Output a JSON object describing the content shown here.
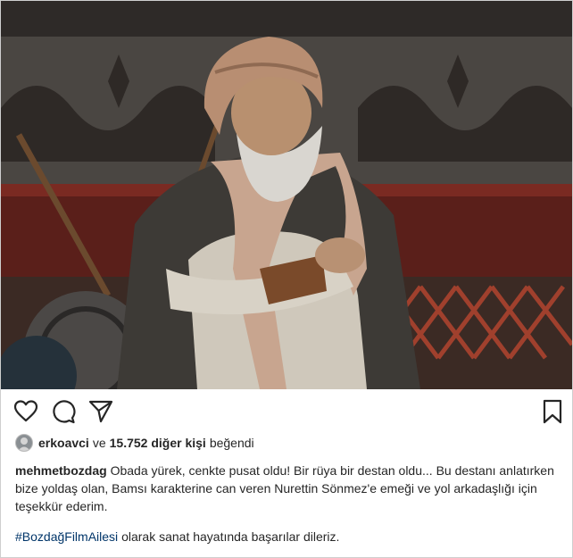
{
  "post": {
    "actions": {
      "like_icon": "heart-outline-icon",
      "comment_icon": "comment-bubble-icon",
      "share_icon": "paper-plane-icon",
      "save_icon": "bookmark-icon"
    },
    "likes": {
      "first_user": "erkoavci",
      "connector": "ve",
      "others": "15.752 diğer kişi",
      "verb": "beğendi"
    },
    "caption": {
      "author": "mehmetbozdag",
      "text": "Obada yürek, cenkte pusat oldu! Bir rüya bir destan oldu... Bu destanı anlatırken bize yoldaş olan, Bamsı karakterine can veren Nurettin Sönmez'e emeği ve yol arkadaşlığı için teşekkür ederim.",
      "hashtag": "#BozdağFilmAilesi",
      "hashtag_suffix": "olarak sanat hayatında başarılar dileriz."
    },
    "colors": {
      "text": "#262626",
      "hashtag": "#003569",
      "border": "#cfcfcf"
    }
  }
}
